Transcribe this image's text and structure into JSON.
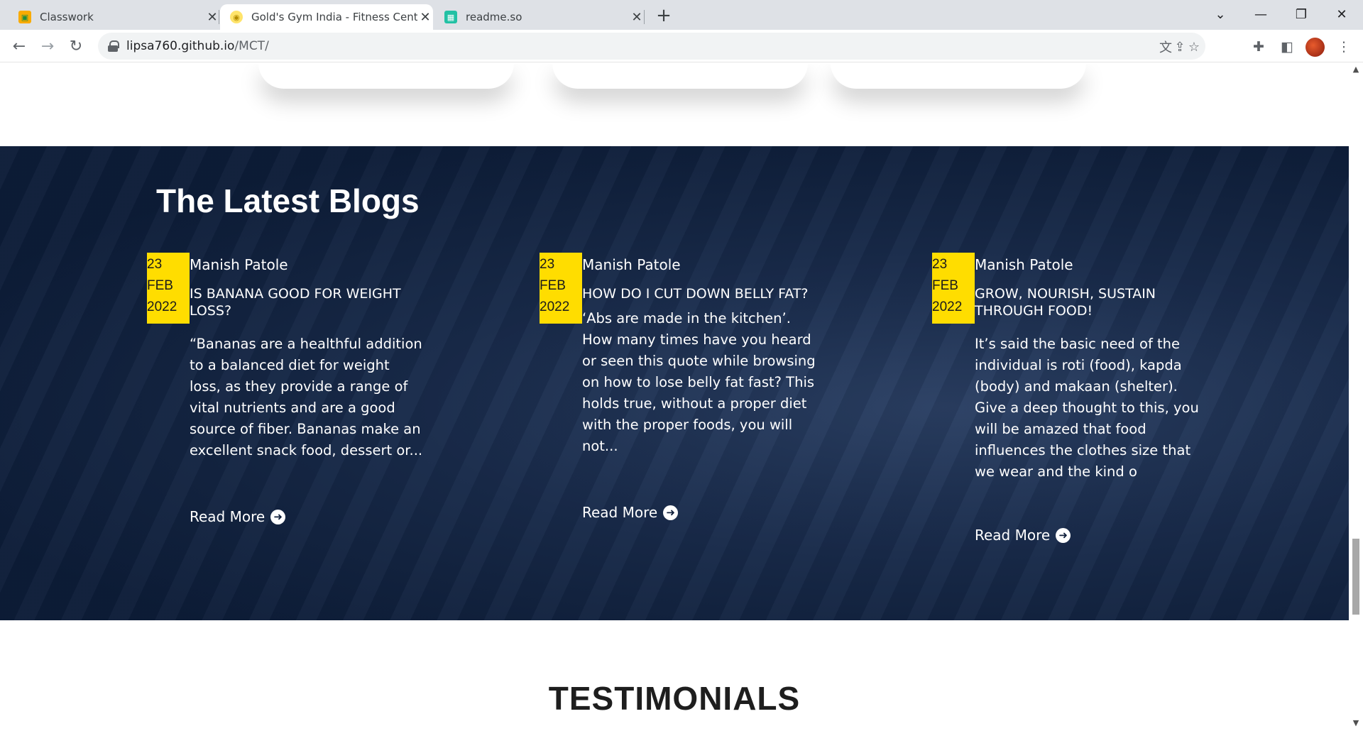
{
  "browser": {
    "tabs": [
      {
        "title": "Classwork",
        "icon": "classroom-icon",
        "active": false
      },
      {
        "title": "Gold's Gym India - Fitness Center",
        "icon": "goldsgym-icon",
        "active": true
      },
      {
        "title": "readme.so",
        "icon": "readme-icon",
        "active": false
      }
    ],
    "url_host": "lipsa760.github.io",
    "url_path": "/MCT/",
    "colors": {
      "tabstrip": "#dee1e6",
      "omnibox": "#f1f3f4"
    }
  },
  "page": {
    "blogs": {
      "heading": "The Latest Blogs",
      "posts": [
        {
          "day": "23",
          "month": "FEB",
          "year": "2022",
          "author": "Manish Patole",
          "title": "IS BANANA GOOD FOR WEIGHT LOSS?",
          "excerpt": "“Bananas are a healthful addition to a balanced diet for weight loss, as they provide a range of vital nutrients and are a good source of fiber. Bananas make an excellent snack food, dessert or...",
          "read_more": "Read More"
        },
        {
          "day": "23",
          "month": "FEB",
          "year": "2022",
          "author": "Manish Patole",
          "title": "HOW DO I CUT DOWN BELLY FAT?",
          "excerpt": "‘Abs are made in the kitchen’. How many times have you heard or seen this quote while browsing on how to lose belly fat fast? This holds true, without a proper diet with the proper foods, you will not...",
          "read_more": "Read More"
        },
        {
          "day": "23",
          "month": "FEB",
          "year": "2022",
          "author": "Manish Patole",
          "title": "GROW, NOURISH, SUSTAIN THROUGH FOOD!",
          "excerpt": "It’s said the basic need of the individual is roti (food), kapda (body) and makaan (shelter). Give a deep thought to this, you will be amazed that food influences the clothes size that we wear and the kind o",
          "read_more": "Read More"
        }
      ],
      "colors": {
        "date_badge": "#ffdd00",
        "section_bg": "#162848"
      }
    },
    "testimonials_heading": "TESTIMONIALS"
  }
}
